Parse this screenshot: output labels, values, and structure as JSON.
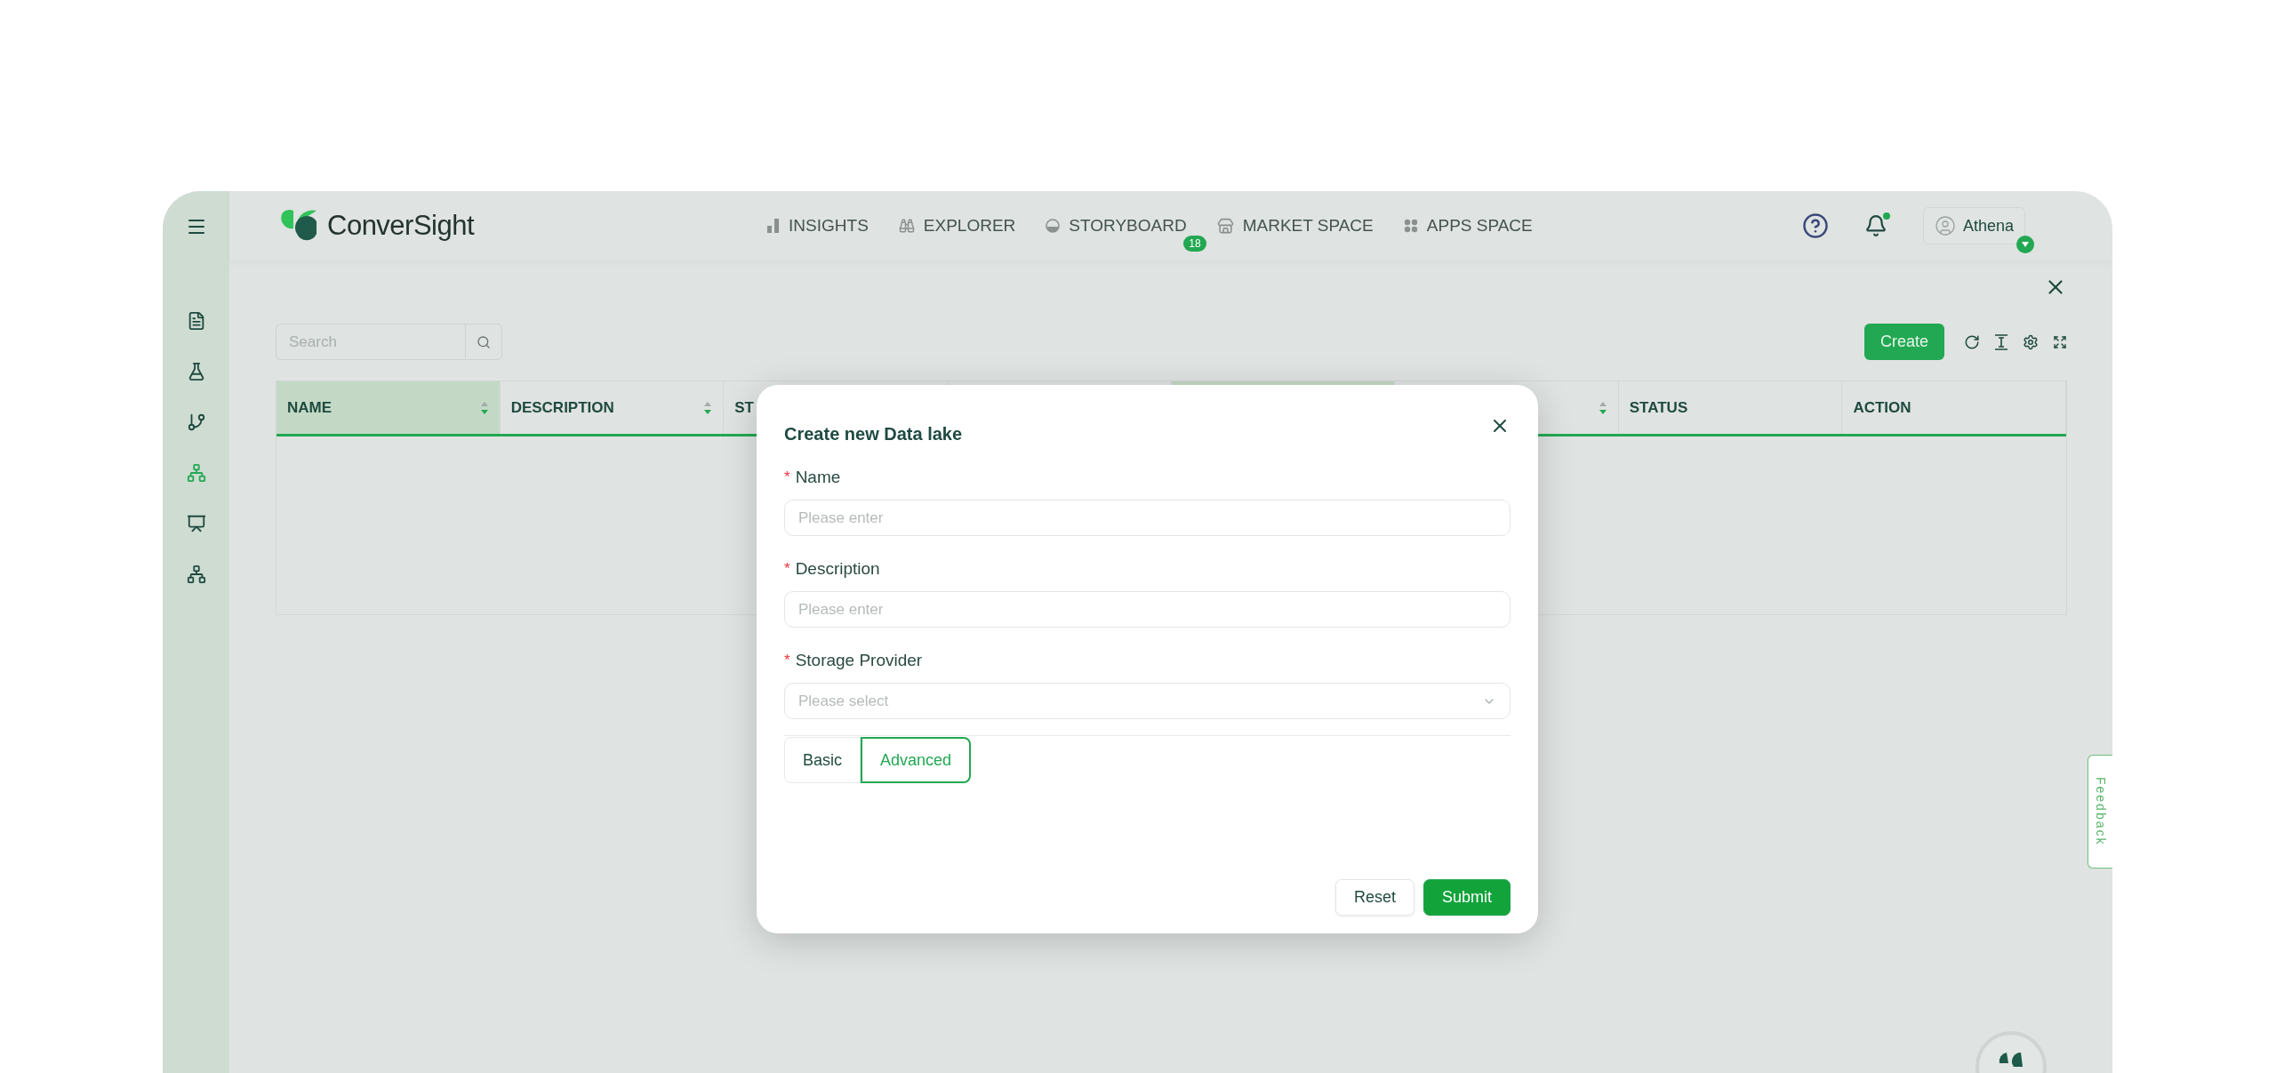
{
  "brand": {
    "name": "ConverSight"
  },
  "nav_items": [
    {
      "label": "INSIGHTS"
    },
    {
      "label": "EXPLORER"
    },
    {
      "label": "STORYBOARD",
      "badge": "18"
    },
    {
      "label": "MARKET SPACE"
    },
    {
      "label": "APPS SPACE"
    }
  ],
  "notifications": {
    "unread": true
  },
  "user": {
    "name": "Athena"
  },
  "sidebar": {
    "items": [
      {
        "selected": false
      },
      {
        "selected": false
      },
      {
        "selected": false
      },
      {
        "selected": true
      },
      {
        "selected": false
      },
      {
        "selected": false
      }
    ]
  },
  "toolbar": {
    "search": {
      "placeholder": "Search"
    },
    "create_button": "Create"
  },
  "table": {
    "columns": [
      {
        "label": "NAME",
        "highlighted": true,
        "sortable": true
      },
      {
        "label": "DESCRIPTION",
        "highlighted": false,
        "sortable": true
      },
      {
        "label": "ST",
        "highlighted": false
      },
      {
        "highlighted": false
      },
      {
        "highlighted": true
      },
      {
        "highlighted": false,
        "sortable": true
      },
      {
        "label": "STATUS",
        "highlighted": false,
        "sortable": false
      },
      {
        "label": "ACTION",
        "highlighted": false,
        "sortable": false
      }
    ]
  },
  "dialog": {
    "title": "Create new Data lake",
    "required_mark": "*",
    "fields": [
      {
        "kind": "text",
        "label": "Name",
        "required": true,
        "placeholder": "Please enter"
      },
      {
        "kind": "text",
        "label": "Description",
        "required": true,
        "placeholder": "Please enter"
      },
      {
        "kind": "select",
        "label": "Storage Provider",
        "required": true,
        "placeholder": "Please select"
      }
    ],
    "tabs": [
      {
        "label": "Basic",
        "selected": false
      },
      {
        "label": "Advanced",
        "selected": true
      }
    ],
    "buttons": [
      {
        "kind": "secondary",
        "label": "Reset"
      },
      {
        "kind": "primary",
        "label": "Submit"
      }
    ]
  },
  "feedback": {
    "label": "Feedback"
  }
}
